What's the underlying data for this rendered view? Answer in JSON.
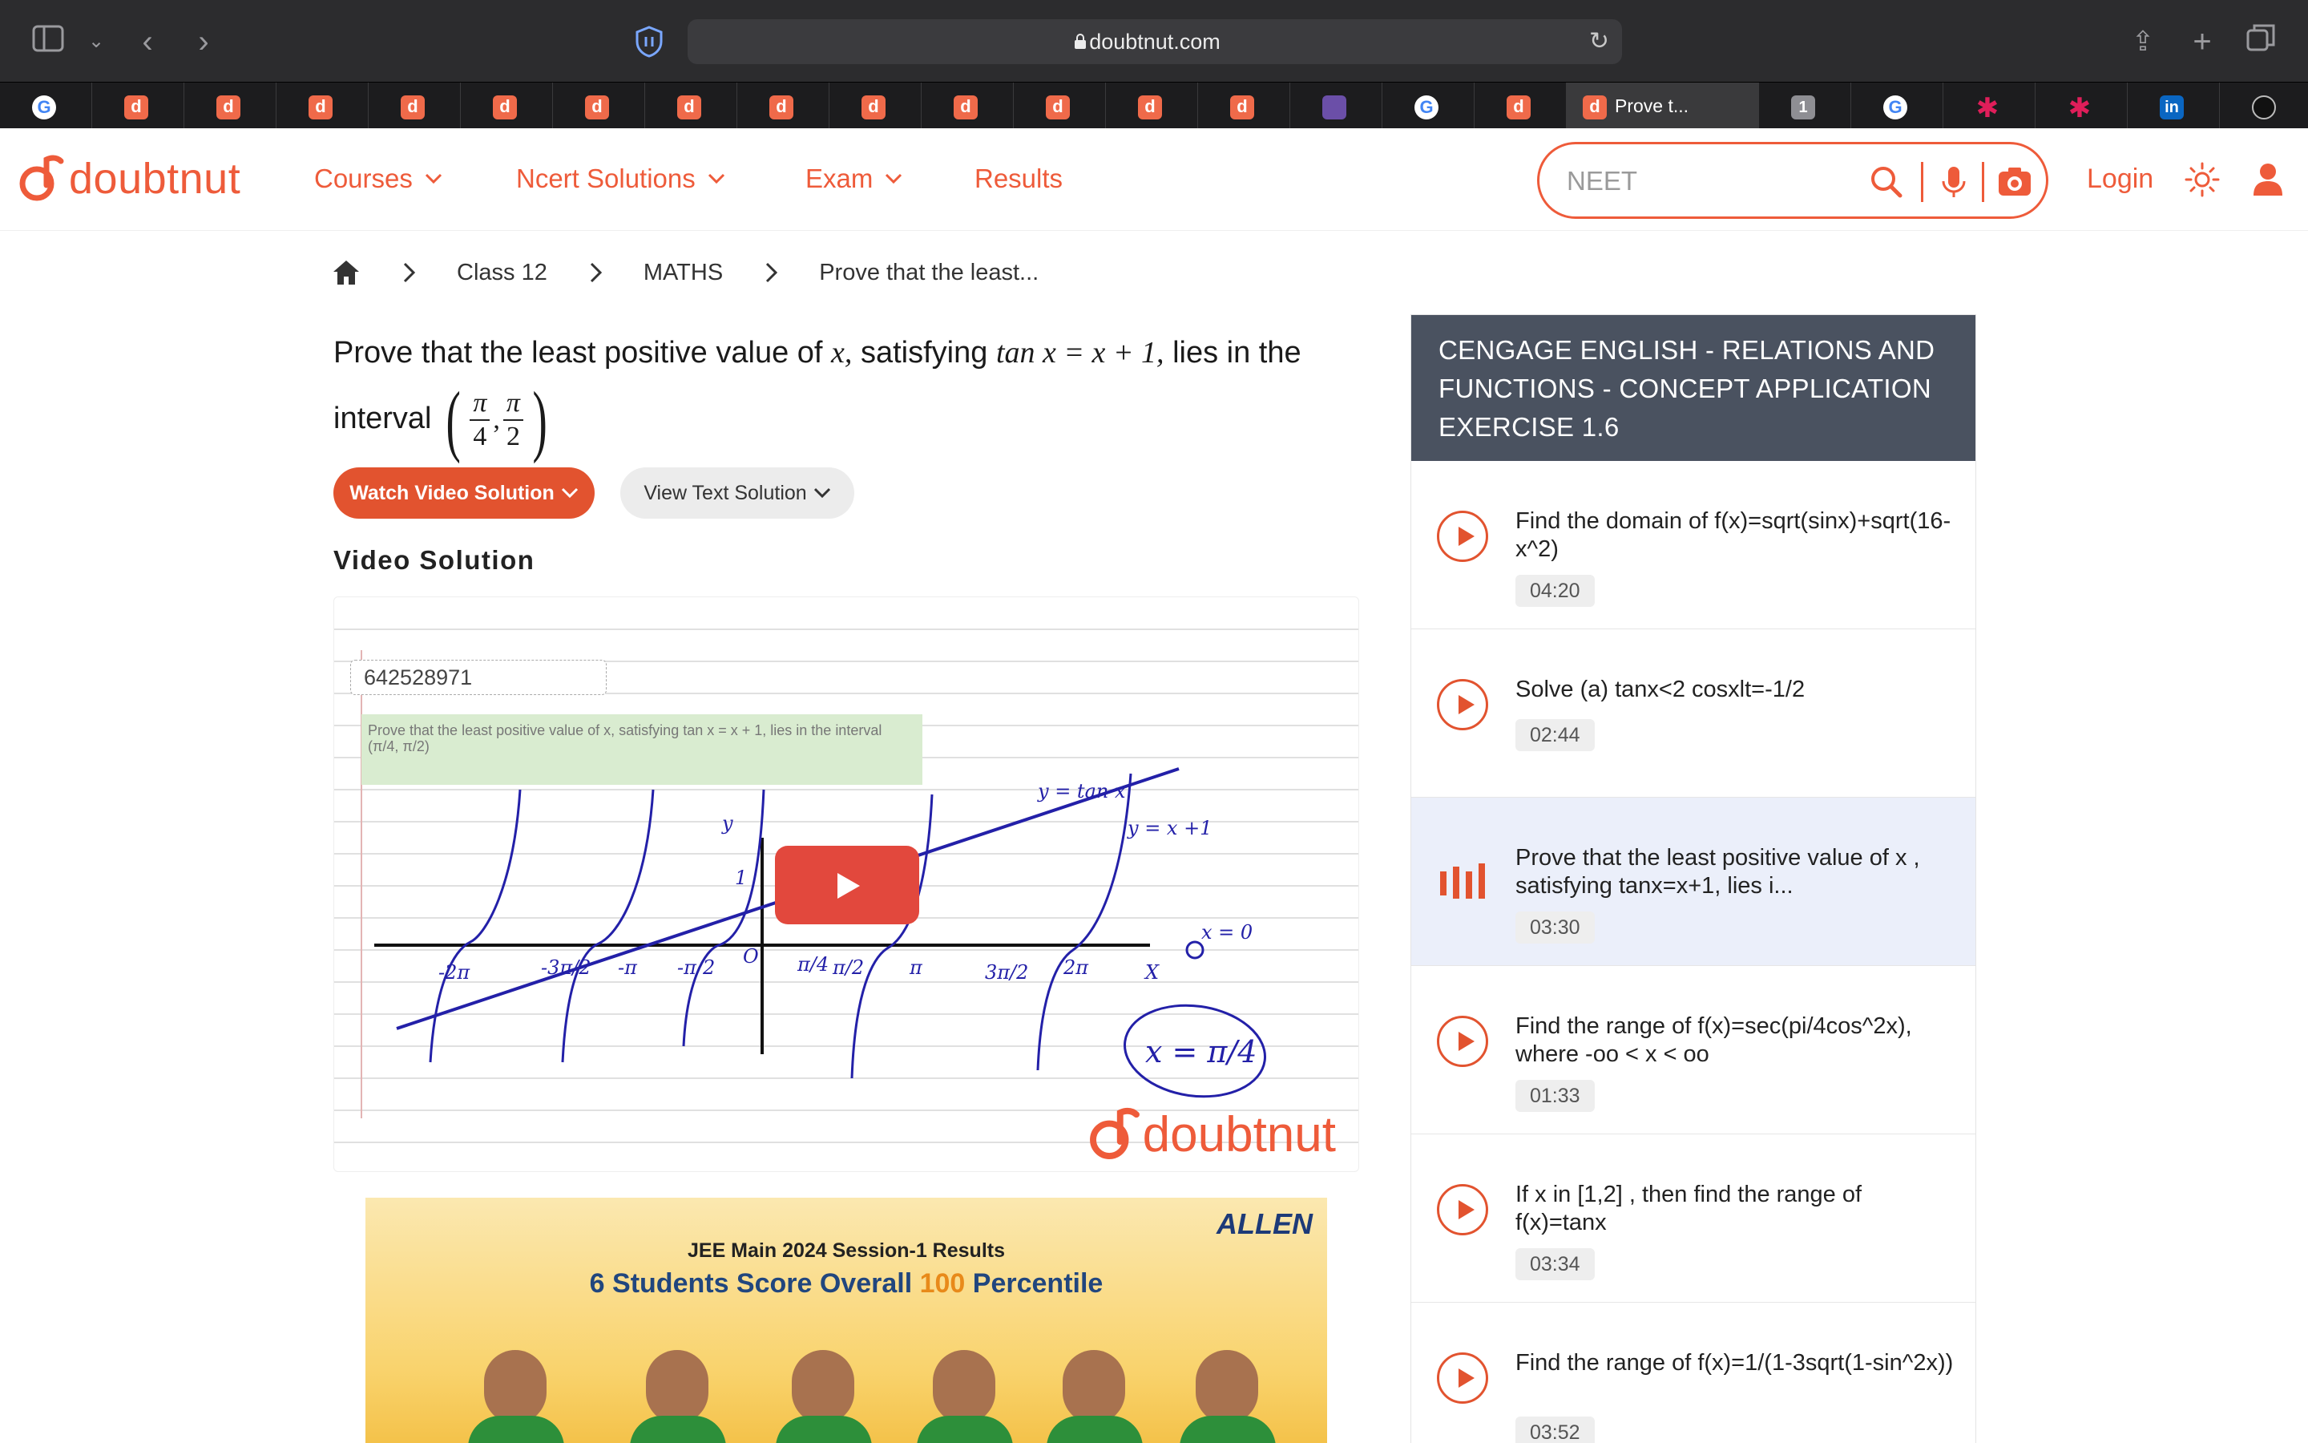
{
  "browser": {
    "url": "doubtnut.com",
    "active_tab_title": "Prove t..."
  },
  "header": {
    "logo_text": "doubtnut",
    "nav": [
      {
        "label": "Courses"
      },
      {
        "label": "Ncert Solutions"
      },
      {
        "label": "Exam"
      },
      {
        "label": "Results"
      }
    ],
    "search_placeholder": "NEET",
    "login_label": "Login"
  },
  "breadcrumb": [
    "Class 12",
    "MATHS",
    "Prove that the least..."
  ],
  "question": {
    "part1": "Prove that the least positive value of ",
    "var_x": "x,",
    "part2": " satisfying ",
    "equation": "tan x = x + 1,",
    "part3": " lies in the interval",
    "frac1_num": "π",
    "frac1_den": "4",
    "frac2_num": "π",
    "frac2_den": "2"
  },
  "buttons": {
    "watch": "Watch Video Solution",
    "view": "View Text Solution"
  },
  "video": {
    "section_title": "Video Solution",
    "id": "642528971",
    "question_snippet": "Prove that the least positive value of x, satisfying tan x = x + 1, lies in the interval (π/4, π/2)",
    "logo_text": "doubtnut"
  },
  "ad": {
    "brand": "ALLEN",
    "line1": "JEE Main 2024 Session-1 Results",
    "line2_prefix": "6 Students Score Overall ",
    "line2_highlight": "100",
    "line2_suffix": " Percentile"
  },
  "sidebar": {
    "heading": "CENGAGE ENGLISH  -  RELATIONS AND FUNCTIONS  -  CONCEPT APPLICATION EXERCISE 1.6",
    "items": [
      {
        "title": "Find the domain of f(x)=sqrt(sinx)+sqrt(16-x^2)",
        "duration": "04:20",
        "active": false
      },
      {
        "title": "Solve (a) tanx<2 cosxlt=-1/2",
        "duration": "02:44",
        "active": false
      },
      {
        "title": "Prove that the least positive value of x , satisfying tanx=x+1, lies i...",
        "duration": "03:30",
        "active": true
      },
      {
        "title": "Find the range of f(x)=sec(pi/4cos^2x), where -oo < x < oo",
        "duration": "01:33",
        "active": false
      },
      {
        "title": "If x in [1,2] , then find the range of f(x)=tanx",
        "duration": "03:34",
        "active": false
      },
      {
        "title": "Find the range of f(x)=1/(1-3sqrt(1-sin^2x))",
        "duration": "03:52",
        "active": false
      }
    ]
  },
  "colors": {
    "brand": "#ee5b3a",
    "sidebar_header": "#4a5260",
    "active_item_bg": "#ebeffa"
  }
}
